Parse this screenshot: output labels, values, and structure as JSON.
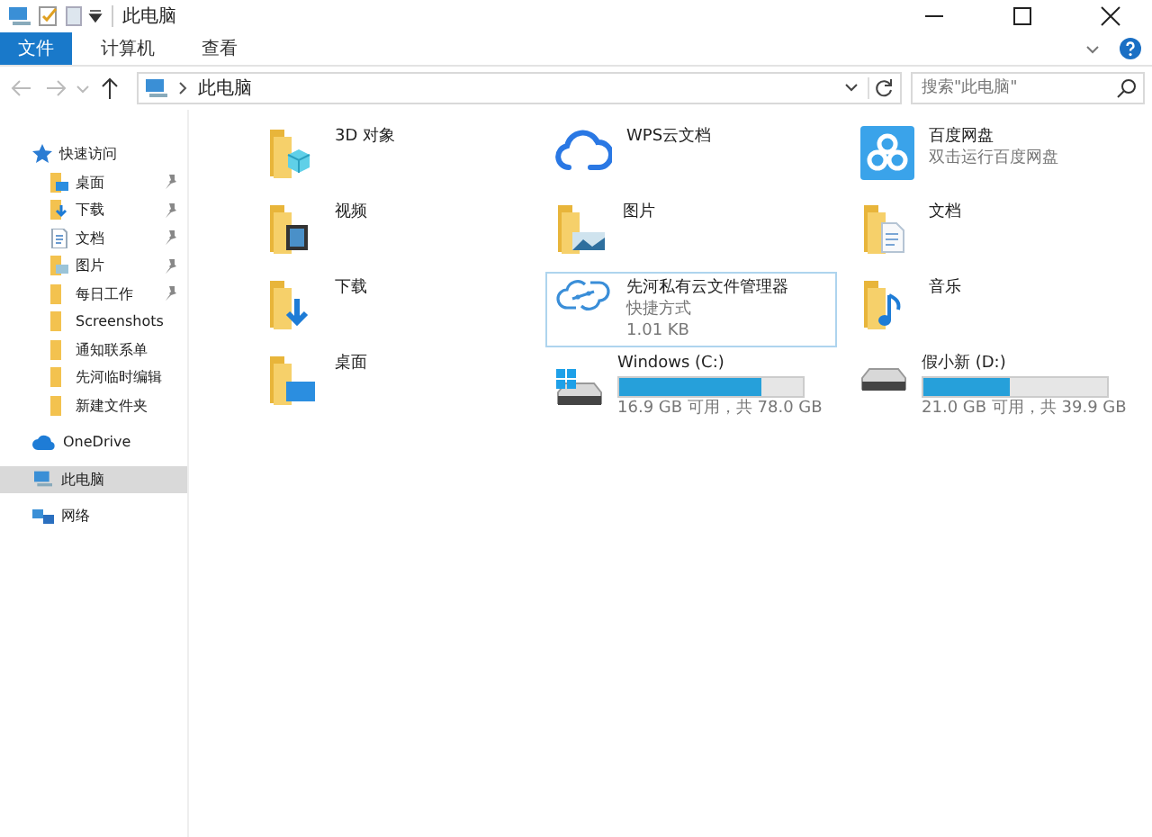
{
  "window": {
    "title": "此电脑"
  },
  "ribbon": {
    "tabs": [
      {
        "label": "文件",
        "selected": true
      },
      {
        "label": "计算机",
        "selected": false
      },
      {
        "label": "查看",
        "selected": false
      }
    ]
  },
  "address": {
    "path": "此电脑",
    "search": {
      "placeholder": "搜索\"此电脑\""
    }
  },
  "sidebar": {
    "items": [
      {
        "label": "快速访问",
        "kind": "star",
        "selected": false,
        "children": [
          {
            "label": "桌面",
            "kind": "desktop",
            "pinned": true,
            "selected": false
          },
          {
            "label": "下载",
            "kind": "download",
            "pinned": true,
            "selected": false
          },
          {
            "label": "文档",
            "kind": "doc",
            "pinned": true,
            "selected": false
          },
          {
            "label": "图片",
            "kind": "pics",
            "pinned": true,
            "selected": false
          },
          {
            "label": "每日工作",
            "kind": "folder",
            "pinned": true,
            "selected": false
          },
          {
            "label": "Screenshots",
            "kind": "folder",
            "pinned": false,
            "selected": false
          },
          {
            "label": "通知联系单",
            "kind": "folder",
            "pinned": false,
            "selected": false
          },
          {
            "label": "先河临时编辑",
            "kind": "folder",
            "pinned": false,
            "selected": false
          },
          {
            "label": "新建文件夹",
            "kind": "folder",
            "pinned": false,
            "selected": false
          }
        ]
      },
      {
        "label": "OneDrive",
        "kind": "cloud",
        "selected": false
      },
      {
        "label": "此电脑",
        "kind": "pc",
        "selected": true
      },
      {
        "label": "网络",
        "kind": "network",
        "selected": false
      }
    ]
  },
  "items": [
    {
      "name": "3D 对象",
      "kind": "folder3d",
      "selected": false
    },
    {
      "name": "WPS云文档",
      "kind": "cloud",
      "selected": false
    },
    {
      "name": "百度网盘",
      "kind": "app",
      "detail": "双击运行百度网盘",
      "selected": false
    },
    {
      "name": "视频",
      "kind": "video",
      "selected": false
    },
    {
      "name": "图片",
      "kind": "pics",
      "selected": false
    },
    {
      "name": "文档",
      "kind": "doc",
      "selected": false
    },
    {
      "name": "下载",
      "kind": "download",
      "selected": false
    },
    {
      "name": "先河私有云文件管理器",
      "kind": "shortcut",
      "detail": "快捷方式",
      "size": "1.01 KB",
      "selected": true
    },
    {
      "name": "音乐",
      "kind": "music",
      "selected": false
    },
    {
      "name": "桌面",
      "kind": "desktop",
      "selected": false
    },
    {
      "name": "Windows (C:)",
      "kind": "drive",
      "system": true,
      "level": 0.77,
      "free": "16.9 GB 可用，共 78.0 GB",
      "selected": false
    },
    {
      "name": "假小新 (D:)",
      "kind": "drive",
      "system": false,
      "level": 0.47,
      "free": "21.0 GB 可用，共 39.9 GB",
      "selected": false
    }
  ]
}
